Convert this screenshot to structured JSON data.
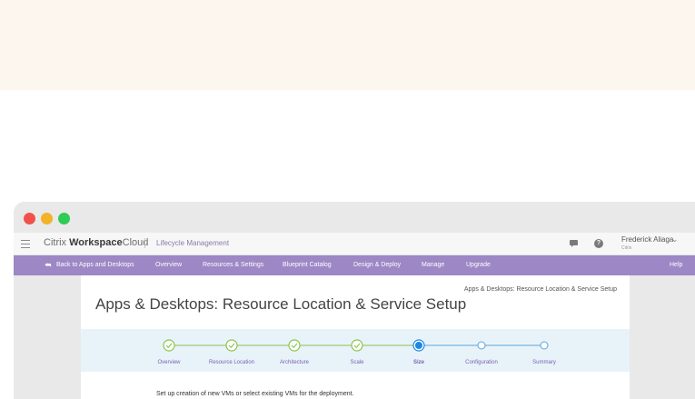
{
  "window": {
    "controls": [
      "close",
      "minimize",
      "zoom"
    ]
  },
  "appbar": {
    "brand_prefix": "Citrix",
    "brand_bold": "Workspace",
    "brand_suffix": "Cloud",
    "subtitle": "Lifecycle Management",
    "icons": [
      "menu-icon",
      "chat-icon",
      "help-icon",
      "chevron-down-icon"
    ],
    "help_glyph": "?",
    "user_name": "Frederick Aliaga",
    "user_org": "Citrix"
  },
  "navbar": {
    "back_label": "Back to Apps and Desktops",
    "items": [
      "Overview",
      "Resources & Settings",
      "Blueprint Catalog",
      "Design & Deploy",
      "Manage",
      "Upgrade"
    ],
    "help_label": "Help"
  },
  "page": {
    "title": "Apps & Desktops: Resource Location & Service Setup",
    "breadcrumb": "Apps & Desktops: Resource Location & Service Setup",
    "instruction": "Set up creation of new VMs or select existing VMs for the deployment."
  },
  "stepper": {
    "steps": [
      {
        "label": "Overview",
        "state": "done"
      },
      {
        "label": "Resource Location",
        "state": "done"
      },
      {
        "label": "Architecture",
        "state": "done"
      },
      {
        "label": "Scale",
        "state": "done"
      },
      {
        "label": "Size",
        "state": "current"
      },
      {
        "label": "Configuration",
        "state": "pending"
      },
      {
        "label": "Summary",
        "state": "pending"
      }
    ]
  },
  "colors": {
    "nav_purple": "#9d87c5",
    "done_green": "#8bc34a",
    "current_blue": "#1e88e5",
    "pending_blue": "#5aa6e0",
    "label_purple": "#7b5fb3"
  }
}
